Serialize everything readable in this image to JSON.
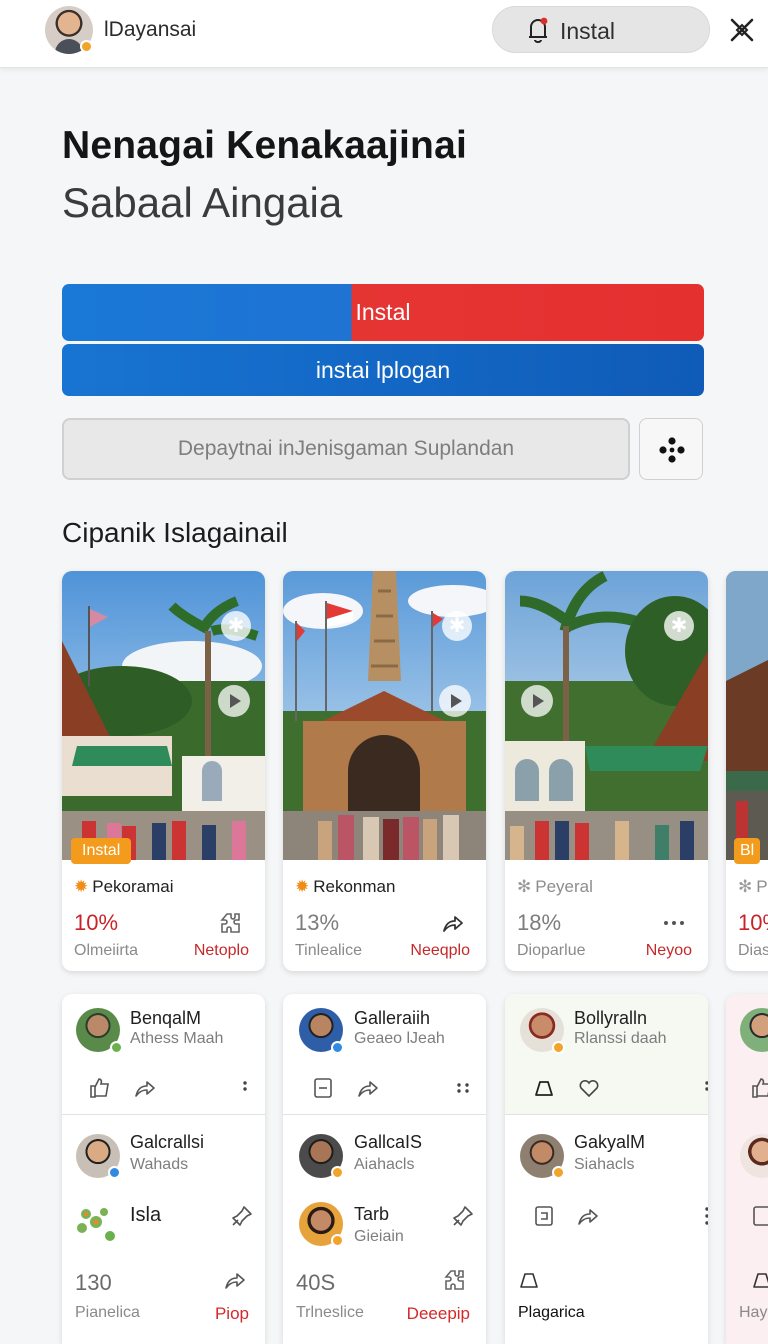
{
  "header": {
    "user_name": "lDayansai",
    "install_label": "Instal",
    "avatar_icon": "user-avatar",
    "bell_icon": "bell-icon",
    "close_icon": "close-icon"
  },
  "hero": {
    "title": "Nenagai Kenakaajinai",
    "subtitle": "Sabaal Aingaia"
  },
  "actions": {
    "primary_label": "Instal",
    "secondary_label": "instai lplogan",
    "search_placeholder": "Depaytnai inJenisgaman Suplandan",
    "filter_icon": "filter-icon"
  },
  "section": {
    "title": "Cipanik Islagainail"
  },
  "media_cards": [
    {
      "tag": "Instal",
      "title": "Pekoramai",
      "percent": "10%",
      "footer_left": "Olmeiirta",
      "footer_right": "Netoplo",
      "icon": "puzzle-icon"
    },
    {
      "tag": "",
      "title": "Rekonman",
      "percent": "13%",
      "footer_left": "Tinlealice",
      "footer_right": "Neeqplo",
      "icon": "share-icon"
    },
    {
      "tag": "",
      "title": "Peyeral",
      "percent": "18%",
      "footer_left": "Dioparlue",
      "footer_right": "Neyoo",
      "icon": "more-icon"
    },
    {
      "tag": "Bl",
      "title": "P",
      "percent": "10%",
      "footer_left": "Dias",
      "footer_right": "",
      "icon": ""
    }
  ],
  "profile_cards": [
    {
      "name1": "BenqalM",
      "sub1": "Athess Maah",
      "name2": "Galcrallsi",
      "sub2": "Wahads",
      "name3": "Isla",
      "number": "130",
      "bottom_left": "Pianelica",
      "bottom_right": "Piop"
    },
    {
      "name1": "Galleraiih",
      "sub1": "Geaeo lJeah",
      "name2": "GallcaIS",
      "sub2": "Aiahacls",
      "name3": "Tarb",
      "sub3": "Gieiain",
      "number": "40S",
      "bottom_left": "Trlneslice",
      "bottom_right": "Deeepip"
    },
    {
      "name1": "Bollyralln",
      "sub1": "Rlanssi daah",
      "name2": "GakyalM",
      "sub2": "Siahacls",
      "bottom_left": "Plagarica"
    },
    {
      "bottom_left": "Hay"
    }
  ],
  "colors": {
    "primary_blue": "#1a78d6",
    "primary_red": "#e53533",
    "accent_orange": "#f39b1c",
    "link_red": "#c9232a"
  }
}
